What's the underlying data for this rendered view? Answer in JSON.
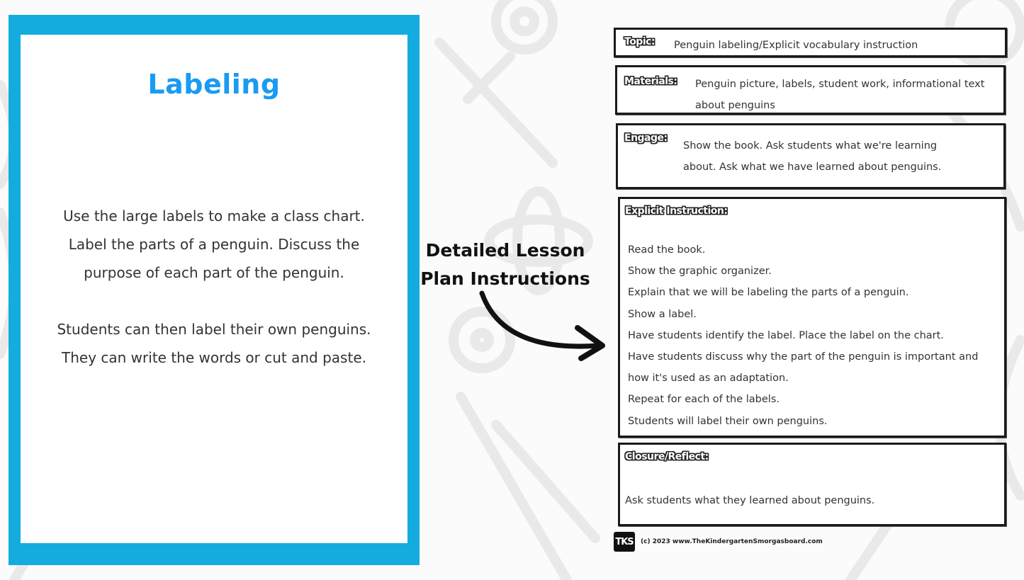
{
  "left_card": {
    "title": "Labeling",
    "paragraph_1": "Use the large labels to make a class chart. Label the parts of a penguin.  Discuss the purpose of each part of the penguin.",
    "paragraph_2": "Students can then label their own penguins.  They can write the words or cut and paste.",
    "frame_color": "#14abdf",
    "title_color": "#1a9bf2"
  },
  "caption": {
    "line_1": "Detailed Lesson",
    "line_2": "Plan Instructions",
    "arrow_icon": "curved-arrow-right-icon"
  },
  "lesson_plan": {
    "topic": {
      "label": "Topic:",
      "value": "Penguin labeling/Explicit vocabulary instruction"
    },
    "materials": {
      "label": "Materials:",
      "value": "Penguin picture, labels, student work, informational text about penguins"
    },
    "engage": {
      "label": "Engage:",
      "value": "Show the book.  Ask students what we're learning about. Ask what we have learned about penguins."
    },
    "explicit_instruction": {
      "label": "Explicit Instruction:",
      "steps": [
        "Read the book.",
        "Show the graphic organizer.",
        "Explain that we will be labeling the parts of a penguin.",
        "Show a label.",
        "Have students identify the label.  Place the label on the chart.",
        "Have students discuss why the part of the penguin is important and how it's used as an adaptation.",
        "Repeat for each of the labels.",
        "Students will label their own penguins."
      ]
    },
    "closure": {
      "label": "Closure/Reflect:",
      "value": "Ask students what they learned about penguins."
    }
  },
  "footer": {
    "logo": "TKS",
    "copyright": "(c) 2023 www.TheKindergartenSmorgasboard.com"
  }
}
